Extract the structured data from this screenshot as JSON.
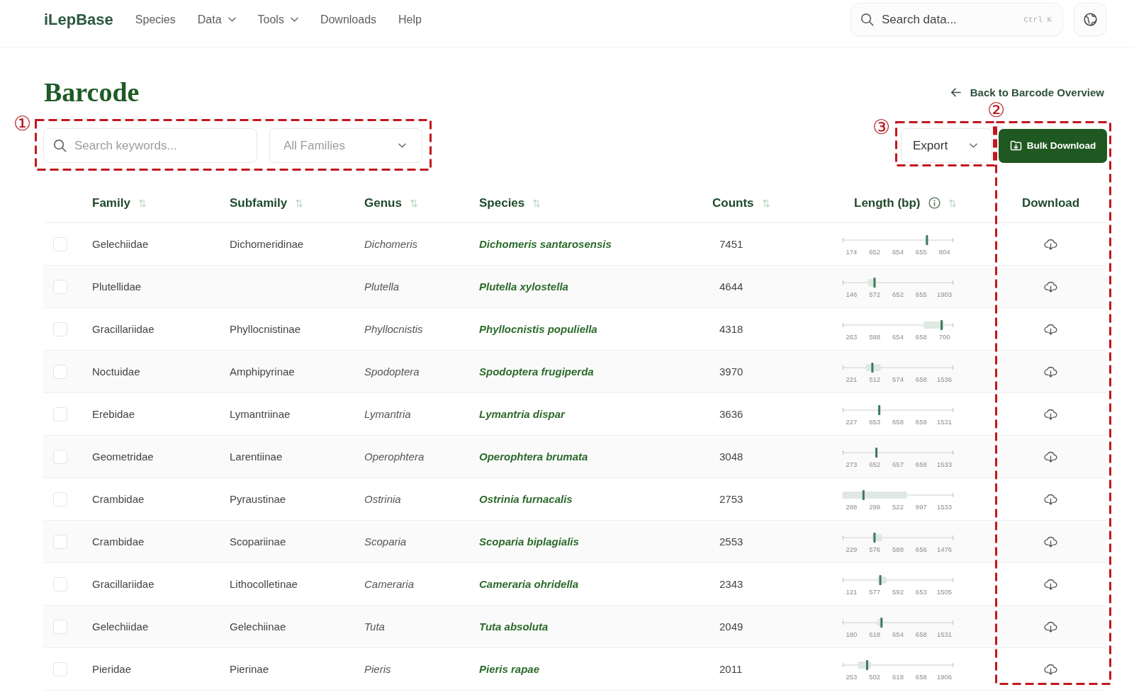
{
  "header": {
    "logo": "iLepBase",
    "nav": [
      {
        "label": "Species",
        "dropdown": false
      },
      {
        "label": "Data",
        "dropdown": true
      },
      {
        "label": "Tools",
        "dropdown": true
      },
      {
        "label": "Downloads",
        "dropdown": false
      },
      {
        "label": "Help",
        "dropdown": false
      }
    ],
    "search": {
      "placeholder": "Search data...",
      "shortcut": "Ctrl K"
    }
  },
  "page": {
    "title": "Barcode",
    "back_link": "Back to Barcode Overview"
  },
  "filters": {
    "search": {
      "placeholder": "Search keywords..."
    },
    "family_select": {
      "value": "All Families"
    }
  },
  "actions": {
    "export": {
      "label": "Export"
    },
    "bulk_download": {
      "label": "Bulk Download"
    }
  },
  "table": {
    "columns": [
      {
        "label": "Family",
        "sortable": true
      },
      {
        "label": "Subfamily",
        "sortable": true
      },
      {
        "label": "Genus",
        "sortable": true
      },
      {
        "label": "Species",
        "sortable": true
      },
      {
        "label": "Counts",
        "sortable": true
      },
      {
        "label": "Length (bp)",
        "sortable": true,
        "info": true
      },
      {
        "label": "Download",
        "sortable": false
      }
    ],
    "rows": [
      {
        "checked": false,
        "family": "Gelechiidae",
        "subfamily": "Dichomeridinae",
        "genus": "Dichomeris",
        "species": "Dichomeris santarosensis",
        "counts": "7451",
        "length": [
          "174",
          "652",
          "654",
          "655",
          "804"
        ]
      },
      {
        "checked": false,
        "family": "Plutellidae",
        "genus": "Plutella",
        "species": "Plutella xylostella",
        "counts": "4644",
        "length": [
          "146",
          "572",
          "652",
          "655",
          "1903"
        ]
      },
      {
        "checked": false,
        "family": "Gracillariidae",
        "subfamily": "Phyllocnistinae",
        "genus": "Phyllocnistis",
        "species": "Phyllocnistis populiella",
        "counts": "4318",
        "length": [
          "263",
          "588",
          "654",
          "658",
          "700"
        ]
      },
      {
        "checked": false,
        "family": "Noctuidae",
        "subfamily": "Amphipyrinae",
        "genus": "Spodoptera",
        "species": "Spodoptera frugiperda",
        "counts": "3970",
        "length": [
          "221",
          "512",
          "574",
          "658",
          "1536"
        ]
      },
      {
        "checked": false,
        "family": "Erebidae",
        "subfamily": "Lymantriinae",
        "genus": "Lymantria",
        "species": "Lymantria dispar",
        "counts": "3636",
        "length": [
          "227",
          "653",
          "658",
          "658",
          "1531"
        ]
      },
      {
        "checked": false,
        "family": "Geometridae",
        "subfamily": "Larentiinae",
        "genus": "Operophtera",
        "species": "Operophtera brumata",
        "counts": "3048",
        "length": [
          "273",
          "652",
          "657",
          "658",
          "1533"
        ]
      },
      {
        "checked": false,
        "family": "Crambidae",
        "subfamily": "Pyraustinae",
        "genus": "Ostrinia",
        "species": "Ostrinia furnacalis",
        "counts": "2753",
        "length": [
          "288",
          "299",
          "522",
          "997",
          "1533"
        ]
      },
      {
        "checked": false,
        "family": "Crambidae",
        "subfamily": "Scopariinae",
        "genus": "Scoparia",
        "species": "Scoparia biplagialis",
        "counts": "2553",
        "length": [
          "229",
          "576",
          "588",
          "656",
          "1476"
        ]
      },
      {
        "checked": false,
        "family": "Gracillariidae",
        "subfamily": "Lithocolletinae",
        "genus": "Cameraria",
        "species": "Cameraria ohridella",
        "counts": "2343",
        "length": [
          "121",
          "577",
          "592",
          "653",
          "1505"
        ]
      },
      {
        "checked": false,
        "family": "Gelechiidae",
        "subfamily": "Gelechiinae",
        "genus": "Tuta",
        "species": "Tuta absoluta",
        "counts": "2049",
        "length": [
          "180",
          "618",
          "654",
          "658",
          "1531"
        ]
      },
      {
        "checked": false,
        "family": "Pieridae",
        "subfamily": "Pierinae",
        "genus": "Pieris",
        "species": "Pieris rapae",
        "counts": "2011",
        "length": [
          "253",
          "502",
          "618",
          "658",
          "1906"
        ]
      }
    ]
  },
  "annotations": [
    {
      "label": "①",
      "kind": "filters"
    },
    {
      "label": "②",
      "kind": "download"
    },
    {
      "label": "③",
      "kind": "export"
    }
  ]
}
